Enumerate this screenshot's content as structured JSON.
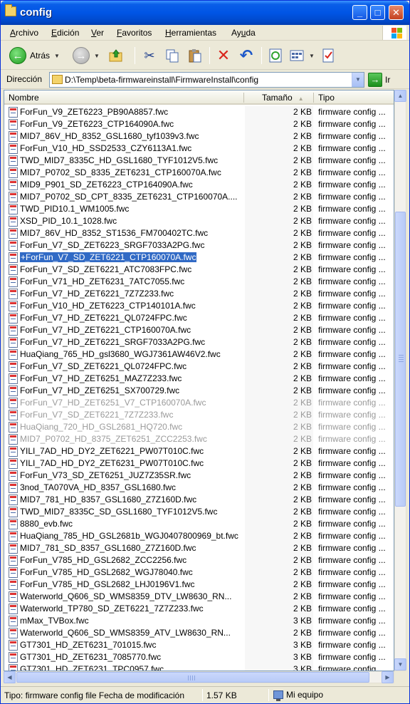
{
  "window": {
    "title": "config",
    "controls": {
      "minimize": "_",
      "maximize": "□",
      "close": "✕"
    }
  },
  "menu": {
    "items": [
      {
        "label_pre": "",
        "label_u": "A",
        "label_post": "rchivo"
      },
      {
        "label_pre": "",
        "label_u": "E",
        "label_post": "dición"
      },
      {
        "label_pre": "",
        "label_u": "V",
        "label_post": "er"
      },
      {
        "label_pre": "",
        "label_u": "F",
        "label_post": "avoritos"
      },
      {
        "label_pre": "",
        "label_u": "H",
        "label_post": "erramientas"
      },
      {
        "label_pre": "Ay",
        "label_u": "u",
        "label_post": "da"
      }
    ]
  },
  "toolbar": {
    "back_label": "Atrás",
    "icons": [
      "back-icon",
      "forward-icon",
      "up-folder-icon",
      "cut-icon",
      "copy-icon",
      "paste-icon",
      "delete-icon",
      "undo-icon",
      "sync-icon",
      "views-icon",
      "properties-icon"
    ]
  },
  "address": {
    "label": "Dirección",
    "path": "D:\\Temp\\beta-firmwareinstall\\FirmwareInstall\\config",
    "go_label": "Ir"
  },
  "columns": {
    "name": "Nombre",
    "size": "Tamaño",
    "type": "Tipo"
  },
  "files": [
    {
      "name": "ForFun_V9_ZET6223_PB90A8857.fwc",
      "size": "2 KB",
      "type": "firmware config ..."
    },
    {
      "name": "ForFun_V9_ZET6223_CTP164090A.fwc",
      "size": "2 KB",
      "type": "firmware config ..."
    },
    {
      "name": "MID7_86V_HD_8352_GSL1680_tyf1039v3.fwc",
      "size": "2 KB",
      "type": "firmware config ..."
    },
    {
      "name": "ForFun_V10_HD_SSD2533_CZY6113A1.fwc",
      "size": "2 KB",
      "type": "firmware config ..."
    },
    {
      "name": "TWD_MID7_8335C_HD_GSL1680_TYF1012V5.fwc",
      "size": "2 KB",
      "type": "firmware config ..."
    },
    {
      "name": "MID7_P0702_SD_8335_ZET6231_CTP160070A.fwc",
      "size": "2 KB",
      "type": "firmware config ..."
    },
    {
      "name": "MID9_P901_SD_ZET6223_CTP164090A.fwc",
      "size": "2 KB",
      "type": "firmware config ..."
    },
    {
      "name": "MID7_P0702_SD_CPT_8335_ZET6231_CTP160070A....",
      "size": "2 KB",
      "type": "firmware config ..."
    },
    {
      "name": "TWD_PID10.1_WM1005.fwc",
      "size": "2 KB",
      "type": "firmware config ..."
    },
    {
      "name": "XSD_PID_10.1_1028.fwc",
      "size": "2 KB",
      "type": "firmware config ..."
    },
    {
      "name": "MID7_86V_HD_8352_ST1536_FM700402TC.fwc",
      "size": "2 KB",
      "type": "firmware config ..."
    },
    {
      "name": "ForFun_V7_SD_ZET6223_SRGF7033A2PG.fwc",
      "size": "2 KB",
      "type": "firmware config ..."
    },
    {
      "name": "+ForFun_V7_SD_ZET6221_CTP160070A.fwc",
      "size": "2 KB",
      "type": "firmware config ...",
      "selected": true
    },
    {
      "name": "ForFun_V7_SD_ZET6221_ATC7083FPC.fwc",
      "size": "2 KB",
      "type": "firmware config ..."
    },
    {
      "name": "ForFun_V71_HD_ZET6231_7ATC7055.fwc",
      "size": "2 KB",
      "type": "firmware config ..."
    },
    {
      "name": "ForFun_V7_HD_ZET6221_7Z7Z233.fwc",
      "size": "2 KB",
      "type": "firmware config ..."
    },
    {
      "name": "ForFun_V10_HD_ZET6223_CTP140101A.fwc",
      "size": "2 KB",
      "type": "firmware config ..."
    },
    {
      "name": "ForFun_V7_HD_ZET6221_QL0724FPC.fwc",
      "size": "2 KB",
      "type": "firmware config ..."
    },
    {
      "name": "ForFun_V7_HD_ZET6221_CTP160070A.fwc",
      "size": "2 KB",
      "type": "firmware config ..."
    },
    {
      "name": "ForFun_V7_HD_ZET6221_SRGF7033A2PG.fwc",
      "size": "2 KB",
      "type": "firmware config ..."
    },
    {
      "name": "HuaQiang_765_HD_gsl3680_WGJ7361AW46V2.fwc",
      "size": "2 KB",
      "type": "firmware config ..."
    },
    {
      "name": "ForFun_V7_SD_ZET6221_QL0724FPC.fwc",
      "size": "2 KB",
      "type": "firmware config ..."
    },
    {
      "name": "ForFun_V7_HD_ZET6251_MAZ7Z233.fwc",
      "size": "2 KB",
      "type": "firmware config ..."
    },
    {
      "name": "ForFun_V7_HD_ZET6251_SX700729.fwc",
      "size": "2 KB",
      "type": "firmware config ..."
    },
    {
      "name": "ForFun_V7_HD_ZET6251_V7_CTP160070A.fwc",
      "size": "2 KB",
      "type": "firmware config ...",
      "faded": true
    },
    {
      "name": "ForFun_V7_SD_ZET6221_7Z7Z233.fwc",
      "size": "2 KB",
      "type": "firmware config ...",
      "faded": true
    },
    {
      "name": "HuaQiang_720_HD_GSL2681_HQ720.fwc",
      "size": "2 KB",
      "type": "firmware config ...",
      "faded": true
    },
    {
      "name": "MID7_P0702_HD_8375_ZET6251_ZCC2253.fwc",
      "size": "2 KB",
      "type": "firmware config ...",
      "faded": true
    },
    {
      "name": "YILI_7AD_HD_DY2_ZET6221_PW07T010C.fwc",
      "size": "2 KB",
      "type": "firmware config ..."
    },
    {
      "name": "YILI_7AD_HD_DY2_ZET6231_PW07T010C.fwc",
      "size": "2 KB",
      "type": "firmware config ..."
    },
    {
      "name": "ForFun_V73_SD_ZET6251_JUZ7Z35SR.fwc",
      "size": "2 KB",
      "type": "firmware config ..."
    },
    {
      "name": "3nod_TA070VA_HD_8357_GSL1680.fwc",
      "size": "2 KB",
      "type": "firmware config ..."
    },
    {
      "name": "MID7_781_HD_8357_GSL1680_Z7Z160D.fwc",
      "size": "2 KB",
      "type": "firmware config ..."
    },
    {
      "name": "TWD_MID7_8335C_SD_GSL1680_TYF1012V5.fwc",
      "size": "2 KB",
      "type": "firmware config ..."
    },
    {
      "name": "8880_evb.fwc",
      "size": "2 KB",
      "type": "firmware config ..."
    },
    {
      "name": "HuaQiang_785_HD_GSL2681b_WGJ0407800969_bt.fwc",
      "size": "2 KB",
      "type": "firmware config ..."
    },
    {
      "name": "MID7_781_SD_8357_GSL1680_Z7Z160D.fwc",
      "size": "2 KB",
      "type": "firmware config ..."
    },
    {
      "name": "ForFun_V785_HD_GSL2682_ZCC2256.fwc",
      "size": "2 KB",
      "type": "firmware config ..."
    },
    {
      "name": "ForFun_V785_HD_GSL2682_WGJ78040.fwc",
      "size": "2 KB",
      "type": "firmware config ..."
    },
    {
      "name": "ForFun_V785_HD_GSL2682_LHJ0196V1.fwc",
      "size": "2 KB",
      "type": "firmware config ..."
    },
    {
      "name": "Waterworld_Q606_SD_WMS8359_DTV_LW8630_RN...",
      "size": "2 KB",
      "type": "firmware config ..."
    },
    {
      "name": "Waterworld_TP780_SD_ZET6221_7Z7Z233.fwc",
      "size": "2 KB",
      "type": "firmware config ..."
    },
    {
      "name": "mMax_TVBox.fwc",
      "size": "3 KB",
      "type": "firmware config ..."
    },
    {
      "name": "Waterworld_Q606_SD_WMS8359_ATV_LW8630_RN...",
      "size": "2 KB",
      "type": "firmware config ..."
    },
    {
      "name": "GT7301_HD_ZET6231_701015.fwc",
      "size": "3 KB",
      "type": "firmware config ..."
    },
    {
      "name": "GT7301_HD_ZET6231_7085770.fwc",
      "size": "3 KB",
      "type": "firmware config ..."
    },
    {
      "name": "GT7301_HD_ZET6231_TPC0957.fwc",
      "size": "3 KB",
      "type": "firmware config ..."
    }
  ],
  "status": {
    "info": "Tipo: firmware config file Fecha de modificación",
    "size": "1.57 KB",
    "location": "Mi equipo"
  }
}
